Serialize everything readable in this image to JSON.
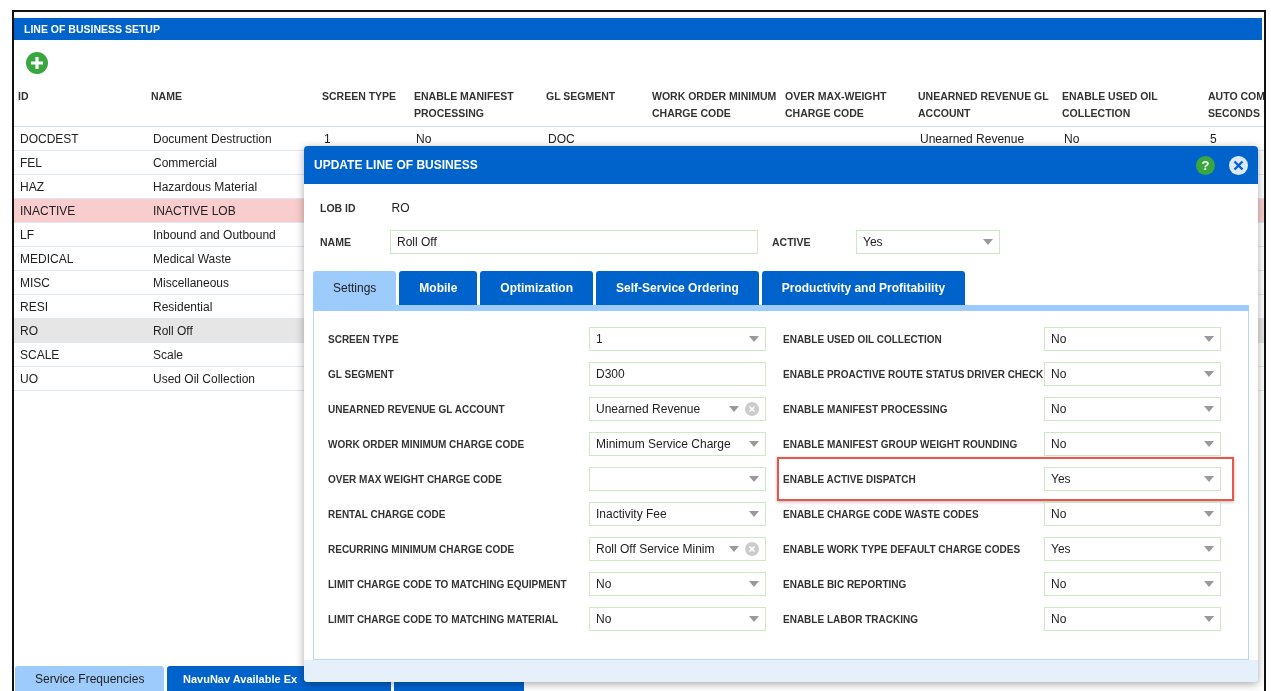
{
  "page": {
    "title": "LINE OF BUSINESS SETUP"
  },
  "table": {
    "columns": [
      "ID",
      "NAME",
      "SCREEN TYPE",
      "ENABLE MANIFEST PROCESSING",
      "GL SEGMENT",
      "WORK ORDER MINIMUM CHARGE CODE",
      "OVER MAX-WEIGHT CHARGE CODE",
      "UNEARNED REVENUE GL ACCOUNT",
      "ENABLE USED OIL COLLECTION",
      "AUTO COM SECONDS"
    ],
    "rows": [
      {
        "cells": [
          "DOCDEST",
          "Document Destruction",
          "1",
          "No",
          "DOC",
          "",
          "",
          "Unearned Revenue",
          "No",
          "5"
        ],
        "selected": false,
        "inactive": false
      },
      {
        "cells": [
          "FEL",
          "Commercial"
        ],
        "selected": false,
        "inactive": false
      },
      {
        "cells": [
          "HAZ",
          "Hazardous Material"
        ],
        "selected": false,
        "inactive": false
      },
      {
        "cells": [
          "INACTIVE",
          "INACTIVE LOB"
        ],
        "selected": false,
        "inactive": true
      },
      {
        "cells": [
          "LF",
          "Inbound and Outbound"
        ],
        "selected": false,
        "inactive": false
      },
      {
        "cells": [
          "MEDICAL",
          "Medical Waste"
        ],
        "selected": false,
        "inactive": false
      },
      {
        "cells": [
          "MISC",
          "Miscellaneous"
        ],
        "selected": false,
        "inactive": false
      },
      {
        "cells": [
          "RESI",
          "Residential"
        ],
        "selected": false,
        "inactive": false
      },
      {
        "cells": [
          "RO",
          "Roll Off"
        ],
        "selected": true,
        "inactive": false
      },
      {
        "cells": [
          "SCALE",
          "Scale"
        ],
        "selected": false,
        "inactive": false
      },
      {
        "cells": [
          "UO",
          "Used Oil Collection"
        ],
        "selected": false,
        "inactive": false
      }
    ]
  },
  "bottom_tabs": [
    {
      "label": "Service Frequencies",
      "selected": true
    },
    {
      "label": "NavuNav Available Ex",
      "selected": false
    }
  ],
  "modal": {
    "title": "UPDATE LINE OF BUSINESS",
    "help": "?",
    "lob_id_label": "LOB ID",
    "lob_id": "RO",
    "name_label": "NAME",
    "name": "Roll Off",
    "active_label": "ACTIVE",
    "active": "Yes",
    "tabs": [
      {
        "label": "Settings",
        "selected": true
      },
      {
        "label": "Mobile",
        "selected": false
      },
      {
        "label": "Optimization",
        "selected": false
      },
      {
        "label": "Self-Service Ordering",
        "selected": false
      },
      {
        "label": "Productivity and Profitability",
        "selected": false
      }
    ],
    "left_fields": [
      {
        "label": "SCREEN TYPE",
        "value": "1",
        "kind": "select"
      },
      {
        "label": "GL SEGMENT",
        "value": "D300",
        "kind": "text"
      },
      {
        "label": "UNEARNED REVENUE GL ACCOUNT",
        "value": "Unearned Revenue",
        "kind": "clearable"
      },
      {
        "label": "WORK ORDER MINIMUM CHARGE CODE",
        "value": "Minimum Service Charge",
        "kind": "select"
      },
      {
        "label": "OVER MAX WEIGHT CHARGE CODE",
        "kind": "select"
      },
      {
        "label": "RENTAL CHARGE CODE",
        "value": "Inactivity Fee",
        "kind": "select"
      },
      {
        "label": "RECURRING MINIMUM CHARGE CODE",
        "value": "Roll Off Service Minim",
        "kind": "clearable"
      },
      {
        "label": "LIMIT CHARGE CODE TO MATCHING EQUIPMENT",
        "value": "No",
        "kind": "select"
      },
      {
        "label": "LIMIT CHARGE CODE TO MATCHING MATERIAL",
        "value": "No",
        "kind": "select"
      }
    ],
    "right_fields": [
      {
        "label": "ENABLE USED OIL COLLECTION",
        "value": "No",
        "highlighted": false
      },
      {
        "label": "ENABLE PROACTIVE ROUTE STATUS DRIVER CHECK",
        "value": "No",
        "highlighted": false
      },
      {
        "label": "ENABLE MANIFEST PROCESSING",
        "value": "No",
        "highlighted": false
      },
      {
        "label": "ENABLE MANIFEST GROUP WEIGHT ROUNDING",
        "value": "No",
        "highlighted": false
      },
      {
        "label": "ENABLE ACTIVE DISPATCH",
        "value": "Yes",
        "highlighted": true
      },
      {
        "label": "ENABLE CHARGE CODE WASTE CODES",
        "value": "No",
        "highlighted": false
      },
      {
        "label": "ENABLE WORK TYPE DEFAULT CHARGE CODES",
        "value": "Yes",
        "highlighted": false
      },
      {
        "label": "ENABLE BIC REPORTING",
        "value": "No",
        "highlighted": false
      },
      {
        "label": "ENABLE LABOR TRACKING",
        "value": "No",
        "highlighted": false
      }
    ]
  }
}
